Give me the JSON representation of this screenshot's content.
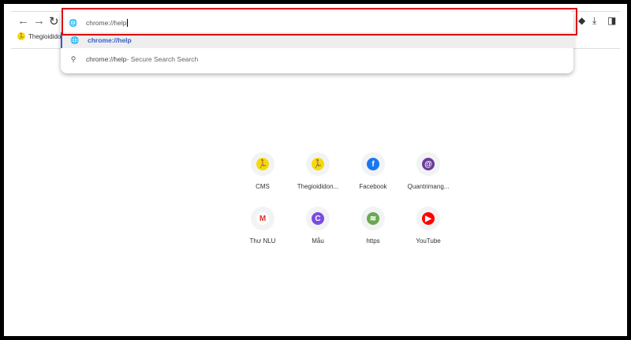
{
  "omnibox": {
    "value": "chrome://help",
    "suggestions": [
      {
        "text": "chrome://help",
        "icon": "globe-icon"
      },
      {
        "text": "chrome://help",
        "suffix": " - Secure Search Search",
        "icon": "search-icon"
      }
    ]
  },
  "bookmarks": [
    {
      "label": "Thegioididon"
    }
  ],
  "shortcuts": [
    {
      "label": "CMS",
      "color": "#f5d90a",
      "glyph": "🏃"
    },
    {
      "label": "Thegioididon...",
      "color": "#f5d90a",
      "glyph": "🏃"
    },
    {
      "label": "Facebook",
      "color": "#1877f2",
      "glyph": "f"
    },
    {
      "label": "Quantrimang...",
      "color": "#6a3d9a",
      "glyph": "@"
    },
    {
      "label": "Thư NLU",
      "color": "#fff",
      "glyph": "M"
    },
    {
      "label": "Mẫu",
      "color": "#7b4ce0",
      "glyph": "C"
    },
    {
      "label": "https",
      "color": "#6aa84f",
      "glyph": "≋"
    },
    {
      "label": "YouTube",
      "color": "#ff0000",
      "glyph": "▶"
    }
  ],
  "colors": {
    "highlight": "#d00000",
    "link": "#3b5bc4"
  }
}
